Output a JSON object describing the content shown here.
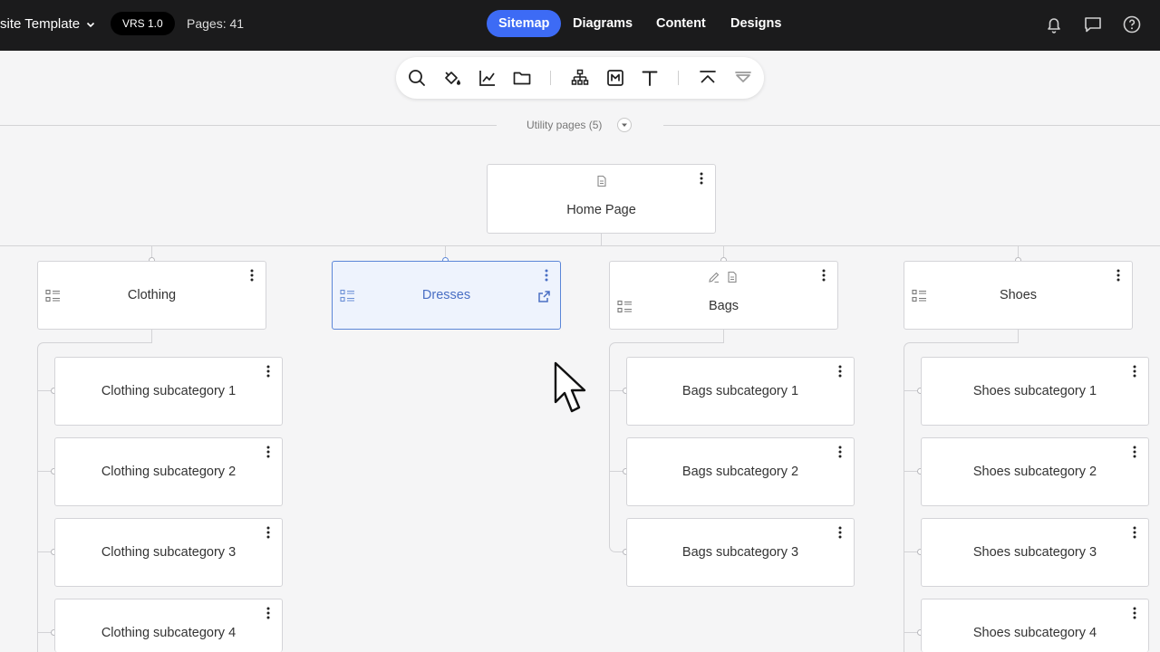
{
  "header": {
    "project_name": "site Template",
    "version": "VRS 1.0",
    "pages": "Pages: 41",
    "nav": [
      {
        "label": "Sitemap",
        "active": true
      },
      {
        "label": "Diagrams",
        "active": false
      },
      {
        "label": "Content",
        "active": false
      },
      {
        "label": "Designs",
        "active": false
      }
    ],
    "icons": [
      "bell-icon",
      "chat-icon",
      "help-icon"
    ]
  },
  "toolbar": {
    "tools": [
      "search-icon",
      "paint-bucket-icon",
      "chart-icon",
      "folder-icon",
      "sitemap-icon",
      "markdown-icon",
      "text-icon",
      "collapse-up-icon",
      "expand-down-icon"
    ]
  },
  "utility": {
    "label": "Utility pages (5)"
  },
  "sitemap": {
    "home": {
      "label": "Home Page"
    },
    "categories": [
      {
        "label": "Clothing",
        "subcategories": [
          "Clothing subcategory 1",
          "Clothing subcategory 2",
          "Clothing subcategory 3",
          "Clothing subcategory 4"
        ]
      },
      {
        "label": "Dresses",
        "selected": true,
        "subcategories": []
      },
      {
        "label": "Bags",
        "subcategories": [
          "Bags subcategory 1",
          "Bags subcategory 2",
          "Bags subcategory 3"
        ]
      },
      {
        "label": "Shoes",
        "subcategories": [
          "Shoes subcategory 1",
          "Shoes subcategory 2",
          "Shoes subcategory 3",
          "Shoes subcategory 4"
        ]
      }
    ]
  },
  "colors": {
    "accent": "#3d6bf5",
    "topbar": "#1b1b1c",
    "selected_border": "#5b86d8",
    "selected_fill": "#eef3fd"
  }
}
